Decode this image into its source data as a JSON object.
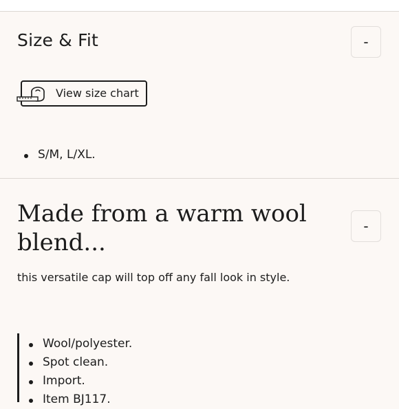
{
  "size_fit": {
    "title": "Size & Fit",
    "toggle_label": "-",
    "size_chart_button": "View size chart",
    "size_chart_icon": "tape-measure-icon",
    "sizes": [
      "S/M, L/XL."
    ]
  },
  "product_info": {
    "title": "Made from a warm wool blend...",
    "toggle_label": "-",
    "description": "this versatile cap will top off any fall look in style.",
    "details": [
      "Wool/polyester.",
      "Spot clean.",
      "Import.",
      "Item BJ117."
    ]
  },
  "colors": {
    "background": "#fcf8f5",
    "text": "#1c1c1c",
    "divider": "#dcd7d3"
  }
}
